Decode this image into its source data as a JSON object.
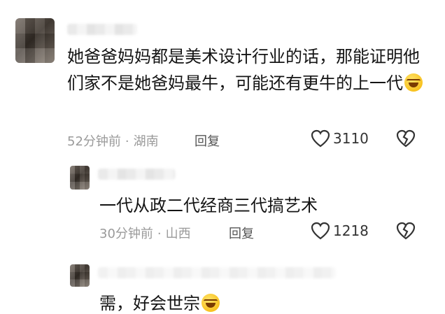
{
  "comments": [
    {
      "content": "她爸爸妈妈都是美术设计行业的话，那能证明他们家不是她爸妈最牛，可能还有更牛的上一代",
      "emoji": "laughing-crying-emoji",
      "time": "52分钟前",
      "location": "湖南",
      "reply_label": "回复",
      "likes": "3110"
    },
    {
      "content": "一代从政二代经商三代搞艺术",
      "time": "30分钟前",
      "location": "山西",
      "reply_label": "回复",
      "likes": "1218"
    },
    {
      "content": "需，好会世宗"
    }
  ],
  "colors": {
    "text": "#141414",
    "meta": "#9a9a9a",
    "icon": "#333333"
  }
}
